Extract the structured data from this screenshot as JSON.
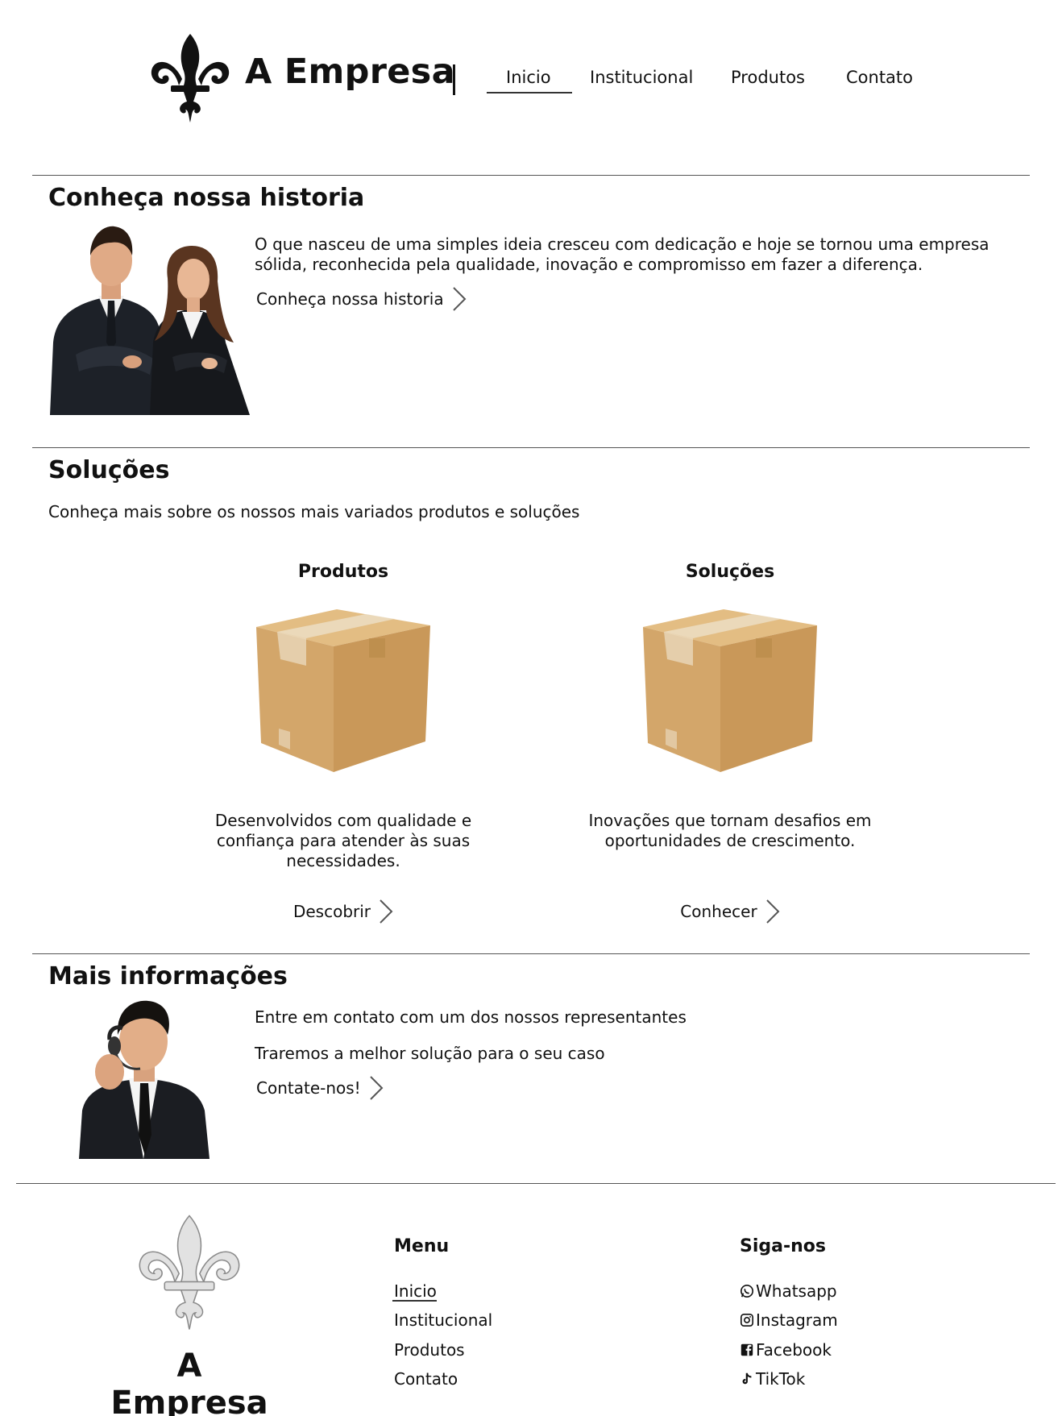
{
  "header": {
    "brand": "A Empresa",
    "nav": [
      {
        "label": "Inicio",
        "active": true
      },
      {
        "label": "Institucional"
      },
      {
        "label": "Produtos"
      },
      {
        "label": "Contato"
      }
    ]
  },
  "history": {
    "title": "Conheça nossa historia",
    "text": "O que nasceu de uma simples ideia cresceu com dedicação e hoje se tornou uma empresa sólida, reconhecida pela qualidade, inovação e compromisso em fazer a diferença.",
    "link": "Conheça nossa historia"
  },
  "solutions": {
    "title": "Soluções",
    "subtitle": "Conheça mais sobre os nossos mais variados produtos e soluções",
    "cards": [
      {
        "title": "Produtos",
        "text": "Desenvolvidos com qualidade e confiança para atender às suas necessidades.",
        "link": "Descobrir"
      },
      {
        "title": "Soluções",
        "text": "Inovações que tornam desafios em oportunidades de crescimento.",
        "link": "Conhecer"
      }
    ]
  },
  "info": {
    "title": "Mais informações",
    "line1": "Entre em contato com um dos nossos representantes",
    "line2": "Traremos a melhor solução para o seu caso",
    "link": "Contate-nos!"
  },
  "footer": {
    "brand": "A Empresa",
    "menu_title": "Menu",
    "menu": [
      "Inicio",
      "Institucional",
      "Produtos",
      "Contato"
    ],
    "social_title": "Siga-nos",
    "social": [
      {
        "label": "Whatsapp",
        "icon": "whatsapp-icon"
      },
      {
        "label": "Instagram",
        "icon": "instagram-icon"
      },
      {
        "label": "Facebook",
        "icon": "facebook-icon"
      },
      {
        "label": "TikTok",
        "icon": "tiktok-icon"
      }
    ]
  },
  "colors": {
    "text": "#111111",
    "divider": "#555555",
    "footer_logo": "#d9d9d9",
    "box": "#d2a86a"
  }
}
